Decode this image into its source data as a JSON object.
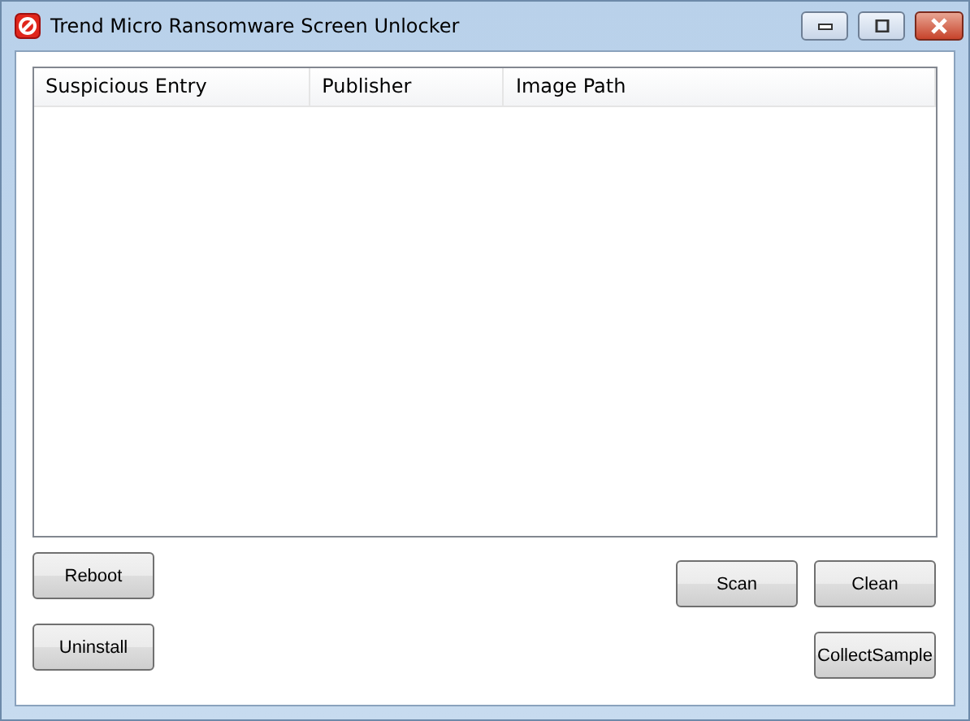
{
  "window": {
    "title": "Trend Micro Ransomware Screen Unlocker"
  },
  "table": {
    "columns": [
      "Suspicious Entry",
      "Publisher",
      "Image Path"
    ]
  },
  "buttons_left": [
    "Reboot",
    "Uninstall"
  ],
  "buttons_right": [
    "Scan",
    "Clean",
    "CollectSample"
  ]
}
